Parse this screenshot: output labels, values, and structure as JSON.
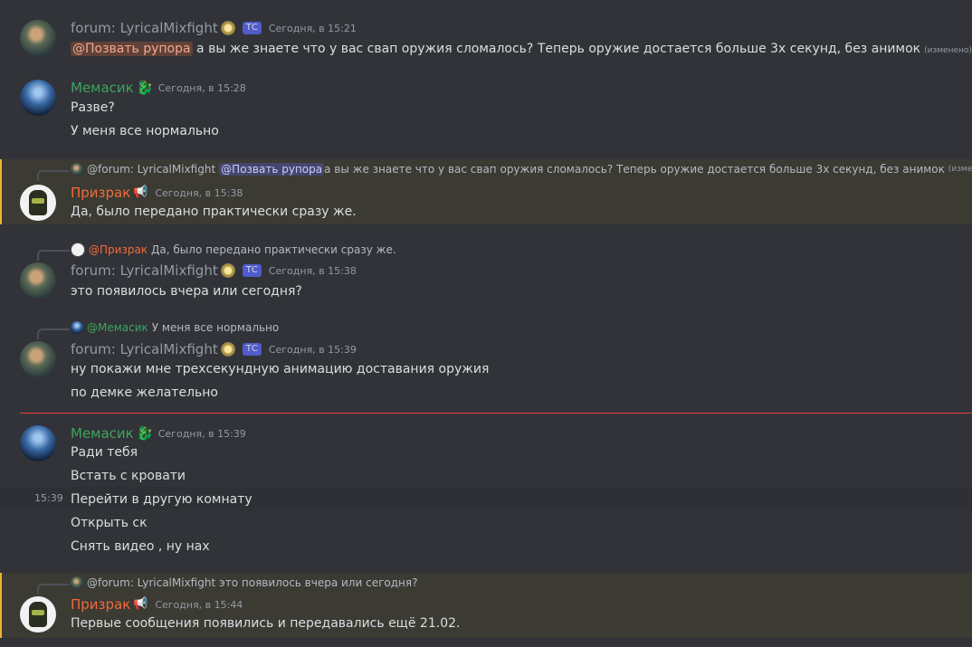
{
  "messages": {
    "m1": {
      "author": "forum: LyricalMixfight",
      "tag": "ТС",
      "time": "Сегодня, в 15:21",
      "mention": "@Позвать рупора",
      "text": " а вы же знаете что у вас свап оружия сломалось? Теперь оружие достается больше 3х секунд, без анимок",
      "edited": "(изменено)"
    },
    "m2": {
      "author": "Мемасик",
      "time": "Сегодня, в 15:28",
      "lines": [
        "Разве?",
        "У меня все нормально"
      ]
    },
    "m3": {
      "reply_author": "@forum: LyricalMixfight",
      "reply_mention": "@Позвать рупора",
      "reply_text": " а вы же знаете что у вас свап оружия сломалось? Теперь оружие достается больше 3х секунд, без анимок",
      "reply_edited": "(изменено)",
      "author": "Призрак",
      "time": "Сегодня, в 15:38",
      "text": "Да, было передано практически сразу же."
    },
    "m4": {
      "reply_author": "@Призрак",
      "reply_text": "Да, было передано практически сразу же.",
      "author": "forum: LyricalMixfight",
      "tag": "ТС",
      "time": "Сегодня, в 15:38",
      "text": "это появилось вчера или сегодня?"
    },
    "m5": {
      "reply_author": "@Мемасик",
      "reply_text": "У меня все нормально",
      "author": "forum: LyricalMixfight",
      "tag": "ТС",
      "time": "Сегодня, в 15:39",
      "lines": [
        "ну покажи мне трехсекундную анимацию доставания оружия",
        "по демке желательно"
      ]
    },
    "m6": {
      "author": "Мемасик",
      "time": "Сегодня, в 15:39",
      "lines": [
        "Ради тебя",
        "Встать с кровати",
        "Перейти в другую комнату",
        "Открыть ск",
        "Снять видео , ну нах"
      ],
      "hover_time": "15:39"
    },
    "m7": {
      "reply_author": "@forum: LyricalMixfight",
      "reply_text": "это появилось вчера или сегодня?",
      "author": "Призрак",
      "time": "Сегодня, в 15:44",
      "text": "Первые сообщения появились и передавались ещё 21.02."
    }
  },
  "icons": {
    "medal": "medal-icon",
    "dragon": "dragon-icon",
    "megaphone": "megaphone-icon"
  },
  "colors": {
    "background": "#313338",
    "mention_highlight": "#3b3a33",
    "mention_bar": "#f0b232",
    "new_messages_line": "#f23f42",
    "memasik": "#3ba55d",
    "prizrak": "#f26b3a"
  }
}
